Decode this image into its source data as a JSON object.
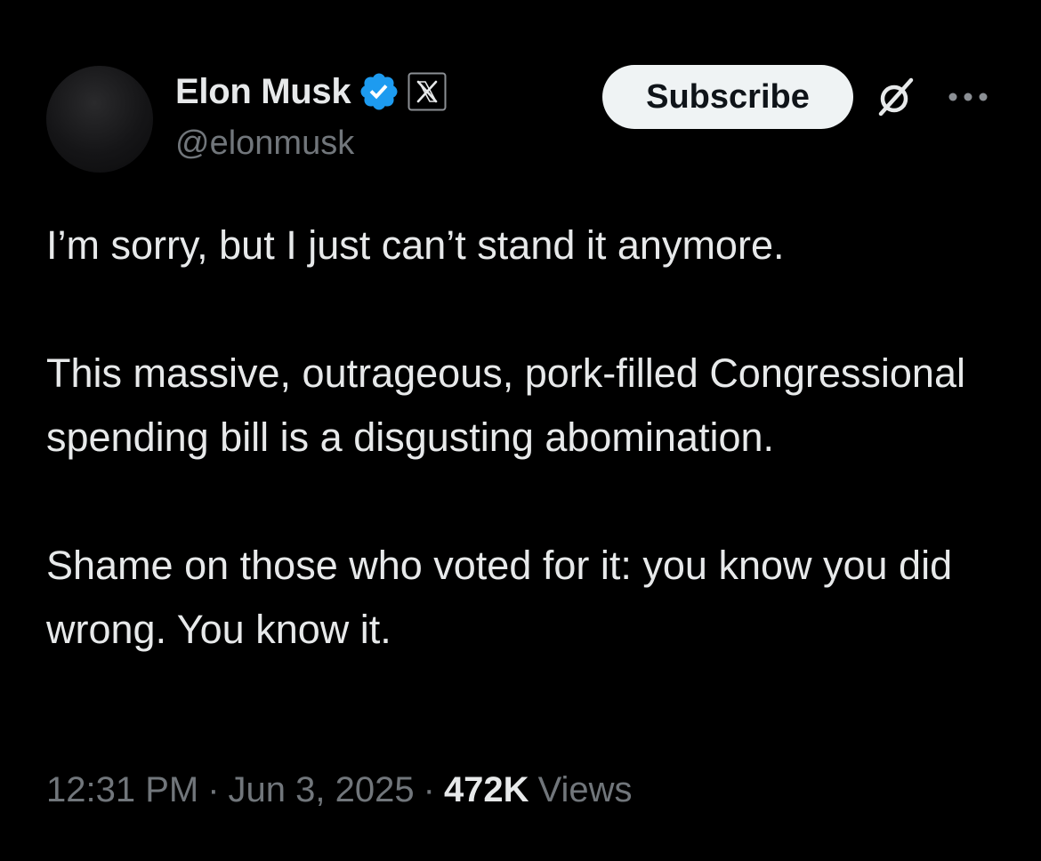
{
  "author": {
    "display_name": "Elon Musk",
    "handle": "@elonmusk",
    "verified": true,
    "affiliation_badge": "x-logo-icon"
  },
  "actions": {
    "subscribe_label": "Subscribe",
    "grok_icon": "grok-icon",
    "more_icon": "more-horizontal-icon"
  },
  "tweet": {
    "paragraphs": [
      "I’m sorry, but I just can’t stand it anymore.",
      "This massive, outrageous, pork-filled Congressional spending bill is a disgusting abomination.",
      "Shame on those who voted for it: you know you did wrong. You know it."
    ]
  },
  "meta": {
    "time": "12:31 PM",
    "separator": "·",
    "date": "Jun 3, 2025",
    "views_count": "472K",
    "views_label": "Views"
  },
  "colors": {
    "background": "#000000",
    "text_primary": "#e7e9ea",
    "text_secondary": "#71767b",
    "verified_blue": "#1d9bf0",
    "subscribe_bg": "#eff3f4",
    "subscribe_text": "#0f1419"
  }
}
